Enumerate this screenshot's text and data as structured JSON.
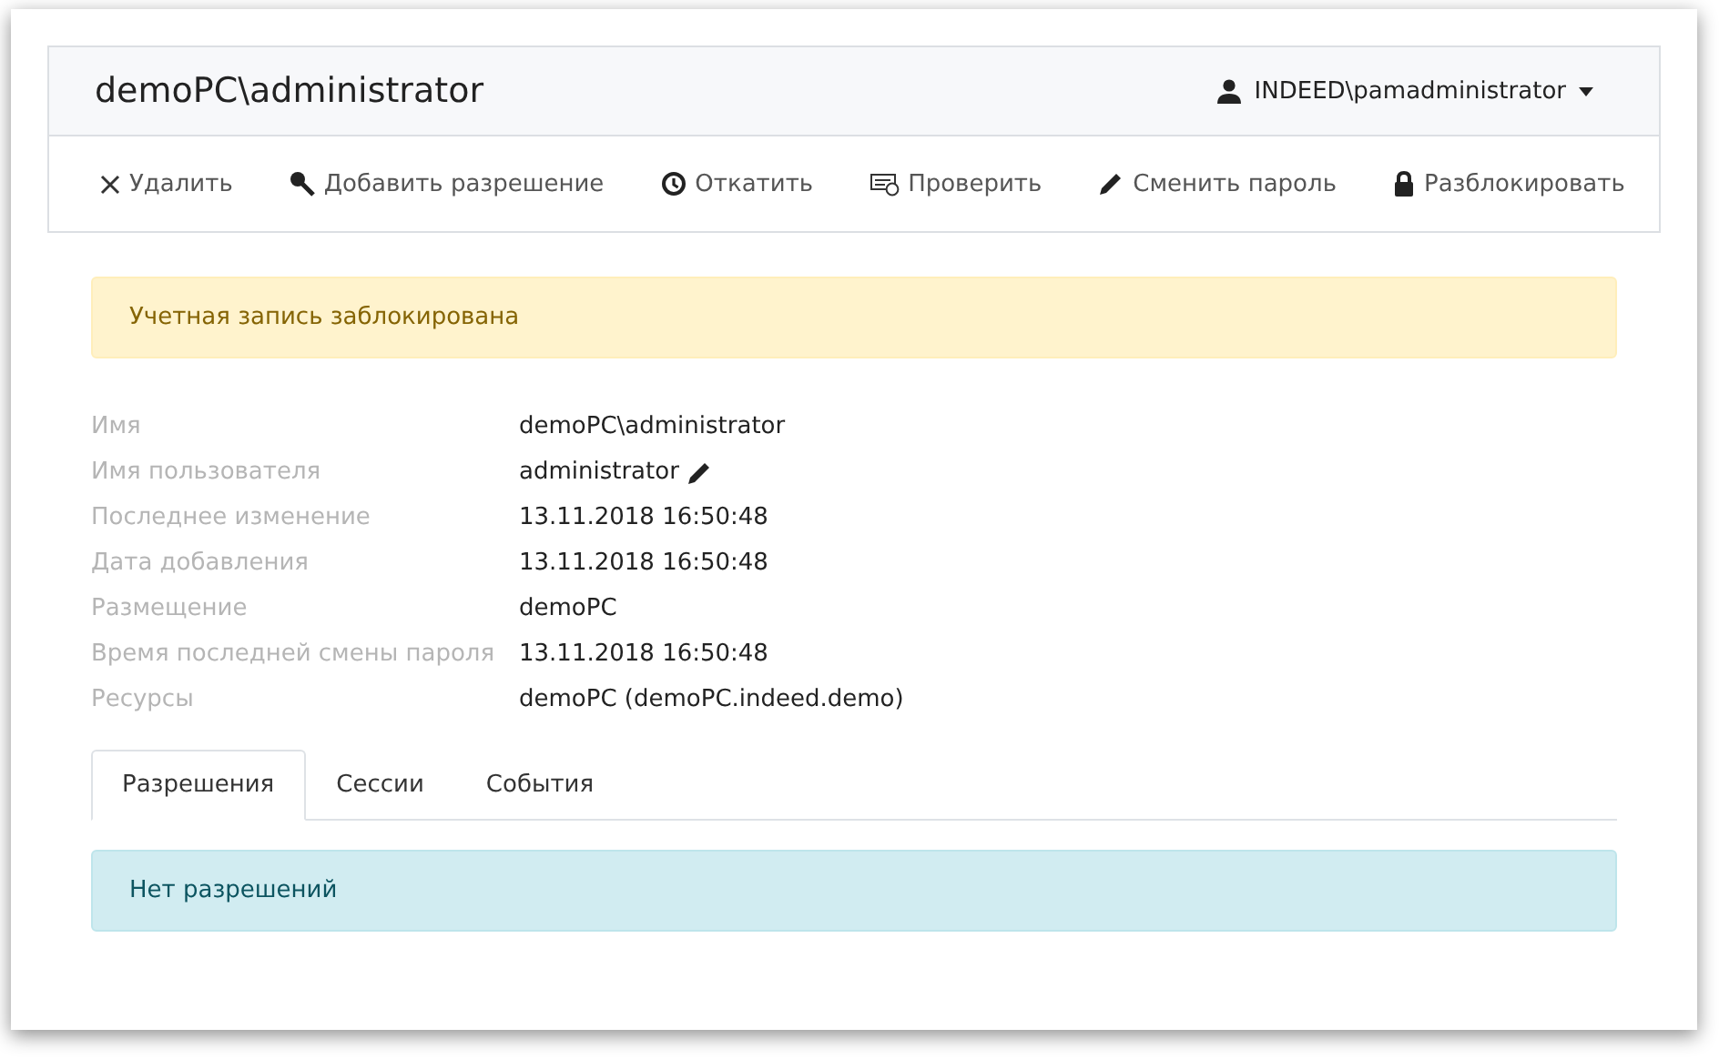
{
  "header": {
    "title": "demoPC\\administrator",
    "user_menu": {
      "label": "INDEED\\pamadministrator"
    }
  },
  "toolbar": [
    {
      "label": "Удалить"
    },
    {
      "label": "Добавить разрешение"
    },
    {
      "label": "Откатить"
    },
    {
      "label": "Проверить"
    },
    {
      "label": "Сменить пароль"
    },
    {
      "label": "Разблокировать"
    }
  ],
  "alert": {
    "kind": "warning",
    "text": "Учетная запись заблокирована"
  },
  "properties": [
    {
      "label": "Имя",
      "value": "demoPC\\administrator",
      "editable": false
    },
    {
      "label": "Имя пользователя",
      "value": "administrator",
      "editable": true
    },
    {
      "label": "Последнее изменение",
      "value": "13.11.2018 16:50:48",
      "editable": false
    },
    {
      "label": "Дата добавления",
      "value": "13.11.2018 16:50:48",
      "editable": false
    },
    {
      "label": "Размещение",
      "value": "demoPC",
      "editable": false
    },
    {
      "label": "Время последней смены пароля",
      "value": "13.11.2018 16:50:48",
      "editable": false
    },
    {
      "label": "Ресурсы",
      "value": "demoPC (demoPC.indeed.demo)",
      "editable": false
    }
  ],
  "tabs": [
    {
      "label": "Разрешения",
      "selected": true
    },
    {
      "label": "Сессии",
      "selected": false
    },
    {
      "label": "События",
      "selected": false
    }
  ],
  "tab_content": {
    "kind": "info",
    "text": "Нет разрешений"
  }
}
